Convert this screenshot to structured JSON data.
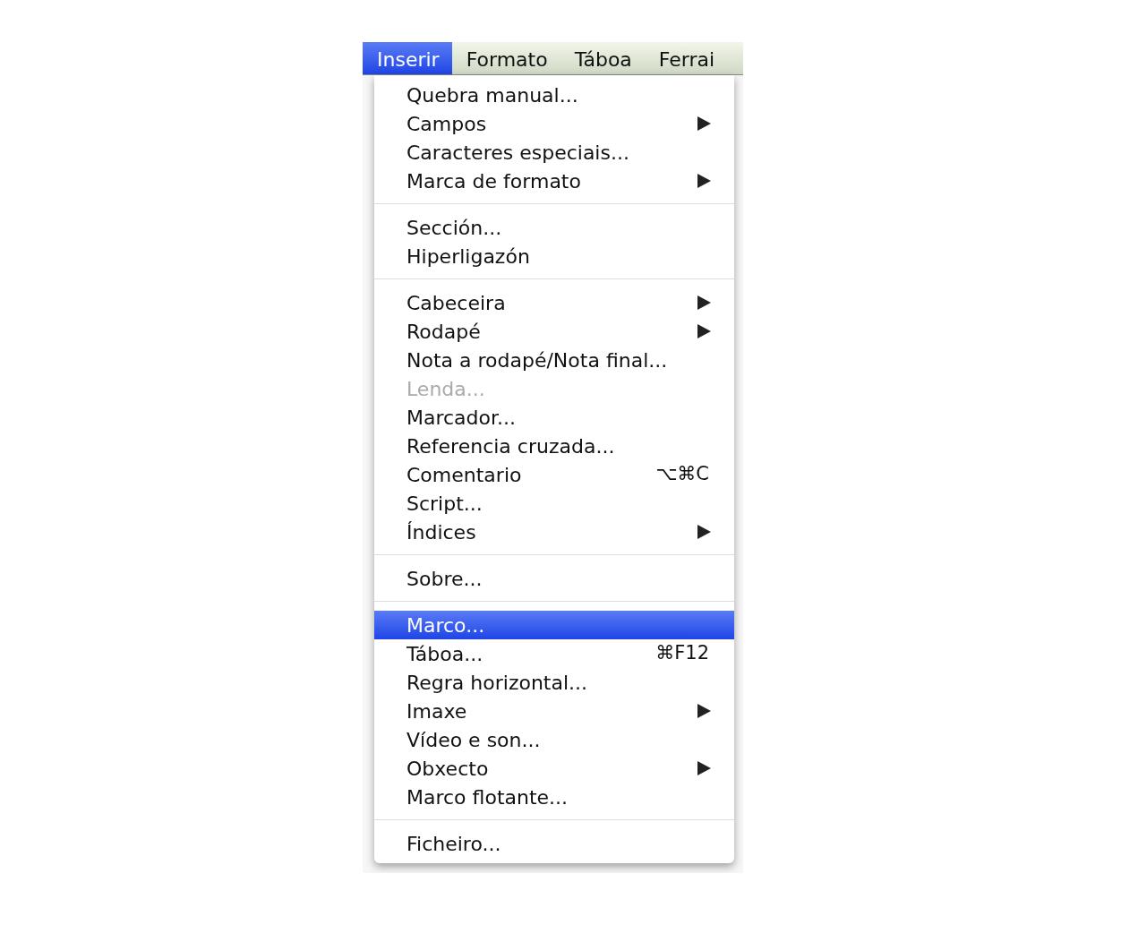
{
  "menubar": [
    {
      "label": "Inserir",
      "selected": true
    },
    {
      "label": "Formato",
      "selected": false
    },
    {
      "label": "Táboa",
      "selected": false
    },
    {
      "label": "Ferrai",
      "selected": false
    }
  ],
  "menu": {
    "items": [
      {
        "kind": "item",
        "label": "Quebra manual...",
        "submenu": false,
        "disabled": false,
        "selected": false
      },
      {
        "kind": "item",
        "label": "Campos",
        "submenu": true,
        "disabled": false,
        "selected": false
      },
      {
        "kind": "item",
        "label": "Caracteres especiais...",
        "submenu": false,
        "disabled": false,
        "selected": false
      },
      {
        "kind": "item",
        "label": "Marca de formato",
        "submenu": true,
        "disabled": false,
        "selected": false
      },
      {
        "kind": "separator"
      },
      {
        "kind": "item",
        "label": "Sección...",
        "submenu": false,
        "disabled": false,
        "selected": false
      },
      {
        "kind": "item",
        "label": "Hiperligazón",
        "submenu": false,
        "disabled": false,
        "selected": false
      },
      {
        "kind": "separator"
      },
      {
        "kind": "item",
        "label": "Cabeceira",
        "submenu": true,
        "disabled": false,
        "selected": false
      },
      {
        "kind": "item",
        "label": "Rodapé",
        "submenu": true,
        "disabled": false,
        "selected": false
      },
      {
        "kind": "item",
        "label": "Nota a rodapé/Nota final...",
        "submenu": false,
        "disabled": false,
        "selected": false
      },
      {
        "kind": "item",
        "label": "Lenda...",
        "submenu": false,
        "disabled": true,
        "selected": false
      },
      {
        "kind": "item",
        "label": "Marcador...",
        "submenu": false,
        "disabled": false,
        "selected": false
      },
      {
        "kind": "item",
        "label": "Referencia cruzada...",
        "submenu": false,
        "disabled": false,
        "selected": false
      },
      {
        "kind": "item",
        "label": "Comentario",
        "shortcut": "⌥⌘C",
        "submenu": false,
        "disabled": false,
        "selected": false
      },
      {
        "kind": "item",
        "label": "Script...",
        "submenu": false,
        "disabled": false,
        "selected": false
      },
      {
        "kind": "item",
        "label": "Índices",
        "submenu": true,
        "disabled": false,
        "selected": false
      },
      {
        "kind": "separator"
      },
      {
        "kind": "item",
        "label": "Sobre...",
        "submenu": false,
        "disabled": false,
        "selected": false
      },
      {
        "kind": "separator"
      },
      {
        "kind": "item",
        "label": "Marco...",
        "submenu": false,
        "disabled": false,
        "selected": true
      },
      {
        "kind": "item",
        "label": "Táboa...",
        "shortcut": "⌘F12",
        "submenu": false,
        "disabled": false,
        "selected": false
      },
      {
        "kind": "item",
        "label": "Regra horizontal...",
        "submenu": false,
        "disabled": false,
        "selected": false
      },
      {
        "kind": "item",
        "label": "Imaxe",
        "submenu": true,
        "disabled": false,
        "selected": false
      },
      {
        "kind": "item",
        "label": "Vídeo e son...",
        "submenu": false,
        "disabled": false,
        "selected": false
      },
      {
        "kind": "item",
        "label": "Obxecto",
        "submenu": true,
        "disabled": false,
        "selected": false
      },
      {
        "kind": "item",
        "label": "Marco flotante...",
        "submenu": false,
        "disabled": false,
        "selected": false
      },
      {
        "kind": "separator"
      },
      {
        "kind": "item",
        "label": "Ficheiro...",
        "submenu": false,
        "disabled": false,
        "selected": false
      }
    ]
  }
}
